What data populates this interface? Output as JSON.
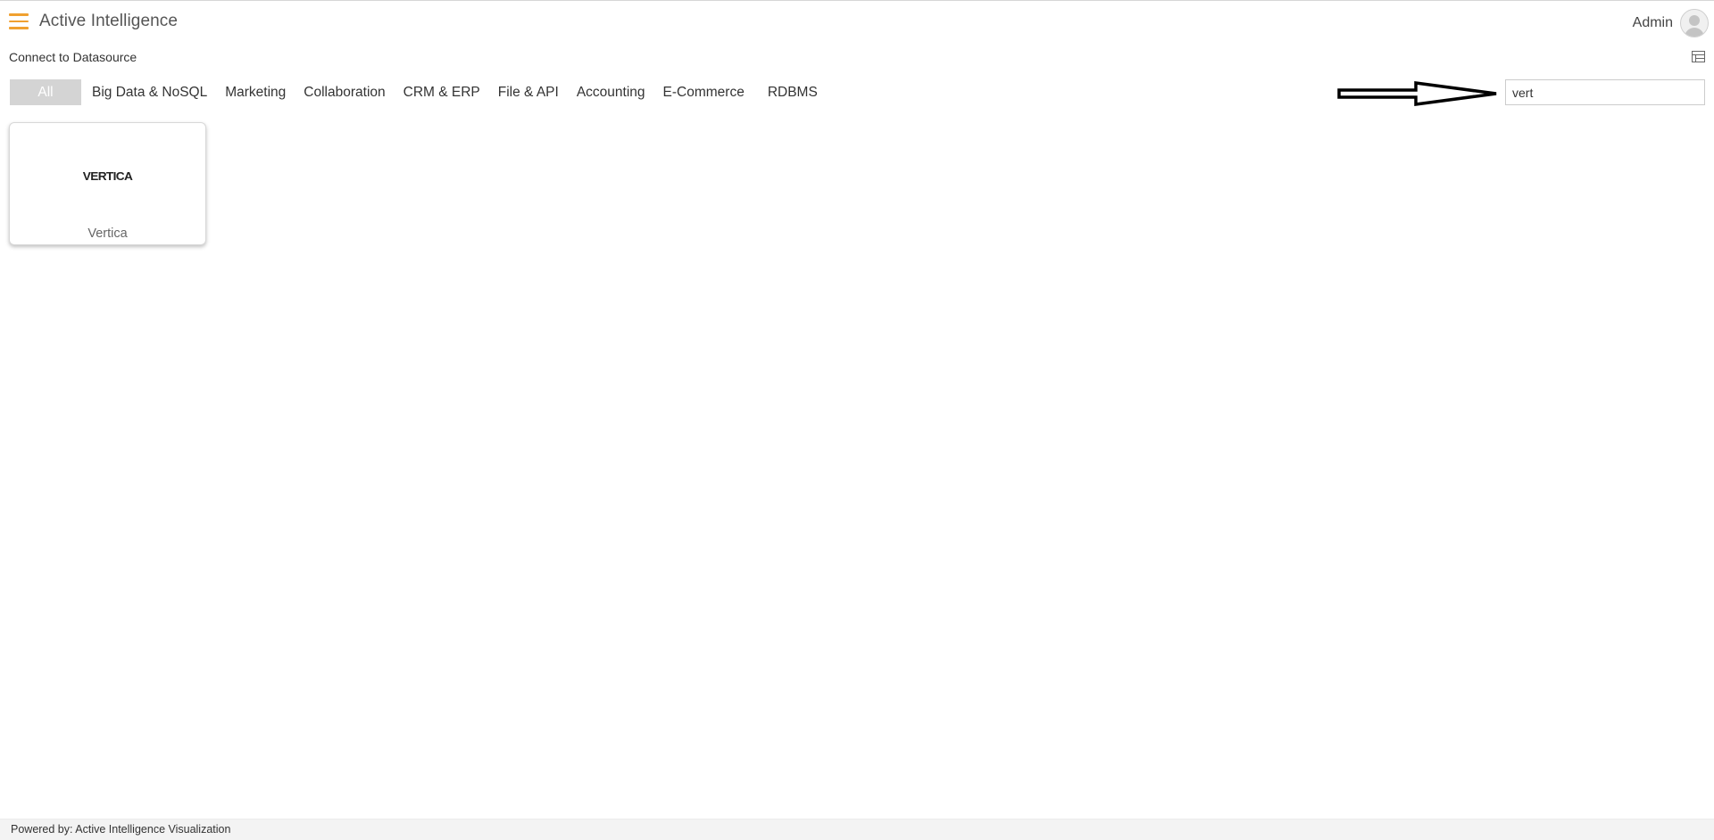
{
  "header": {
    "title": "Active Intelligence",
    "user_name": "Admin",
    "menu_icon": "hamburger-menu-icon",
    "avatar_icon": "user-avatar-icon",
    "accent_color": "#f0a030"
  },
  "subheader": {
    "title": "Connect to Datasource",
    "view_toggle_icon": "table-grid-icon"
  },
  "tabs": [
    {
      "label": "All",
      "active": true
    },
    {
      "label": "Big Data & NoSQL",
      "active": false
    },
    {
      "label": "Marketing",
      "active": false
    },
    {
      "label": "Collaboration",
      "active": false
    },
    {
      "label": "CRM & ERP",
      "active": false
    },
    {
      "label": "File & API",
      "active": false
    },
    {
      "label": "Accounting",
      "active": false
    },
    {
      "label": "E-Commerce",
      "active": false
    },
    {
      "label": "RDBMS",
      "active": false
    }
  ],
  "search": {
    "value": "vert",
    "annotation_icon": "right-arrow-icon"
  },
  "results": [
    {
      "logo_text": "VERTICA",
      "label": "Vertica"
    }
  ],
  "footer": {
    "text": "Powered by: Active Intelligence Visualization"
  }
}
